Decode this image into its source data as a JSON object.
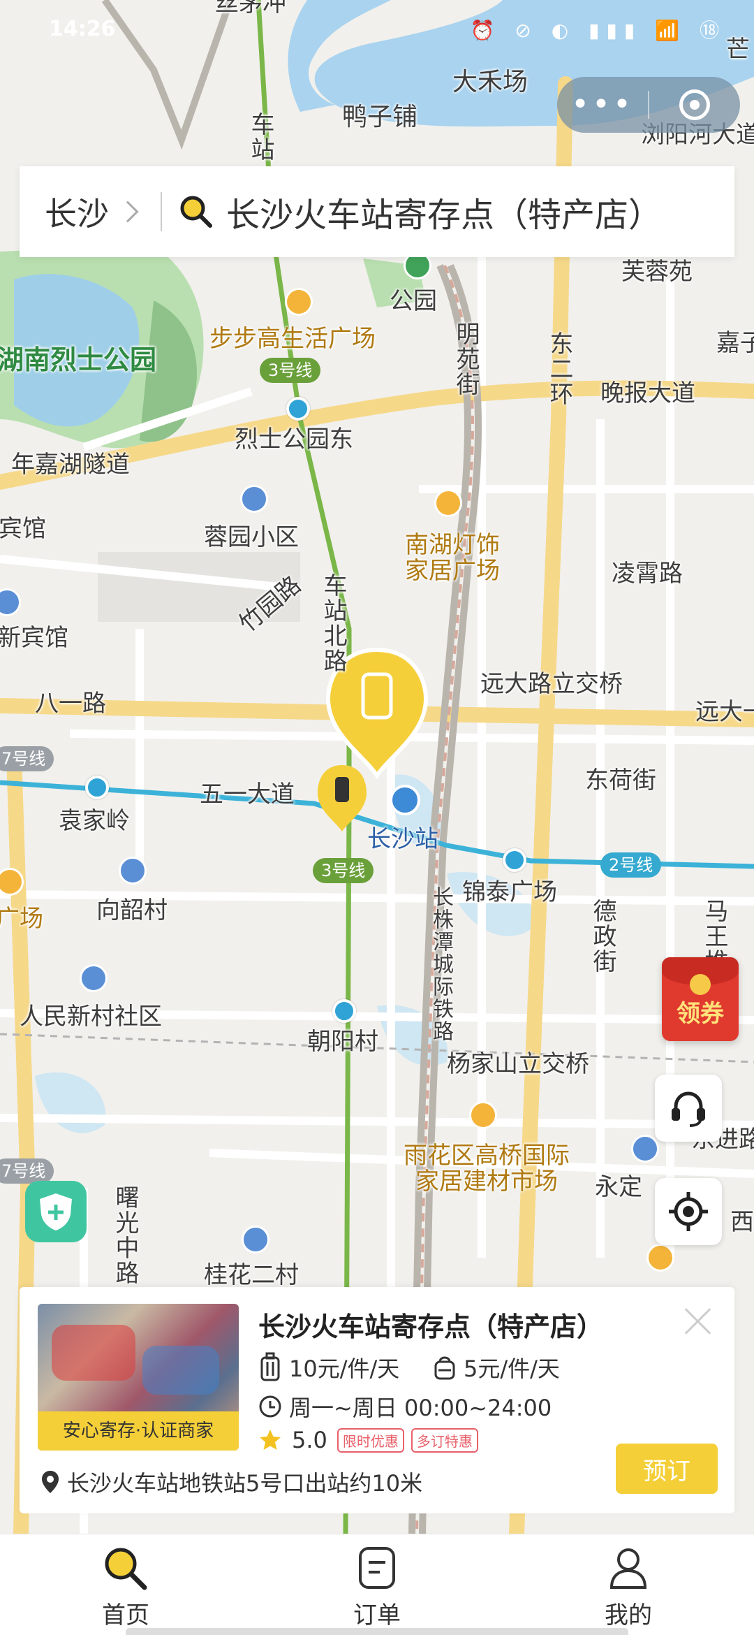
{
  "status_bar": {
    "time": "14:26",
    "icons": "⏰ ⊘ ◐ ▮▮▮ 📶 ⑱"
  },
  "capsule": {
    "more_label": "•••"
  },
  "search": {
    "city": "长沙",
    "query": "长沙火车站寄存点（特产店）"
  },
  "map": {
    "labels": {
      "wujiachong": "丝茅冲",
      "dahechang": "大禾场",
      "yazipu": "鸭子铺",
      "liuyanghe": "浏阳河大道",
      "mang": "芒",
      "furongyuan": "芙蓉苑",
      "gongyuan": "公园",
      "bubugao": "步步高生活广场",
      "hunan_lieshi": "湖南烈士公园",
      "mingyuan": "明苑街",
      "dongerhuan": "东二环",
      "wanbao": "晚报大道",
      "jiazi": "嘉子",
      "lieshi_east": "烈士公园东",
      "nianjia": "年嘉湖隧道",
      "binguan": "宾馆",
      "rongyuan": "蓉园小区",
      "nanhu": "南湖灯饰家居广场",
      "lingxiao": "凌霄路",
      "zhuyuan": "竹园路",
      "xinbinguan": "新宾馆",
      "chezhan_bei": "车站北路",
      "chezhan": "车站",
      "yuanda": "远大路立交桥",
      "yuanda2": "远大一",
      "bayi": "八一路",
      "wuyi": "五一大道",
      "donghe": "东荷街",
      "yuanjialing": "袁家岭",
      "changsha_zhan": "长沙站",
      "jintai": "锦泰广场",
      "xiangshao": "向韶村",
      "changzhutan": "长株潭城际铁路",
      "dezheng": "德政街",
      "mawang": "马王堆",
      "guangchang": "广场",
      "renmin": "人民新村社区",
      "chaoyang": "朝阳村",
      "yangjiashan": "杨家山立交桥",
      "yuhua": "雨花区高桥国际家居建材市场",
      "yongding": "永定",
      "dongjin": "东进路",
      "xi": "西",
      "shuguang": "曙光中路",
      "guihua": "桂花二村"
    },
    "line_badges": {
      "l3a": "3号线",
      "l3b": "3号线",
      "l2": "2号线",
      "l7a": "7号线",
      "l7b": "7号线"
    },
    "coupon_label": "领券"
  },
  "card": {
    "title": "长沙火车站寄存点（特产店）",
    "thumb_badge": "安心寄存·认证商家",
    "price_large": "10元/件/天",
    "price_small": "5元/件/天",
    "hours": "周一~周日 00:00~24:00",
    "rating": "5.0",
    "tags": [
      "限时优惠",
      "多订特惠"
    ],
    "address": "长沙火车站地铁站5号口出站约10米",
    "book_label": "预订"
  },
  "tabs": [
    {
      "label": "首页",
      "icon": "search-icon"
    },
    {
      "label": "订单",
      "icon": "order-icon"
    },
    {
      "label": "我的",
      "icon": "profile-icon"
    }
  ],
  "colors": {
    "accent": "#f4cf38",
    "metro2": "#35a9cf",
    "metro3": "#6aa03a",
    "water": "#aed6ef",
    "park": "#b9dfb0"
  }
}
